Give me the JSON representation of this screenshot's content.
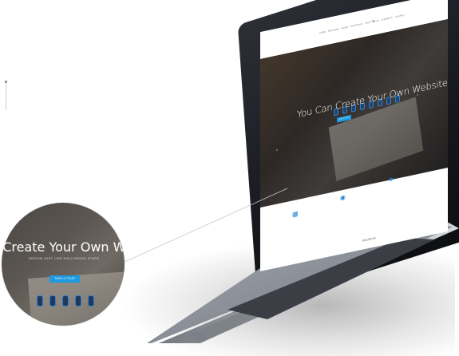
{
  "hero": {
    "title": "You Can Create Your Own Website",
    "cta_label": "TAKE A TOUR"
  },
  "magnifier": {
    "title": "n Create Your Own W",
    "subtitle": "DESIGN JUST LIKE HOLLYWOOD STARS",
    "cta_label": "TAKE A TOUR"
  },
  "device": {
    "brand": "MacBook"
  },
  "nav": {
    "links": [
      "HOME",
      "FEATURES",
      "PAGES",
      "PORTFOLIO",
      "SHOP",
      "BLOG",
      "ELEMENTS",
      "CONTACT"
    ]
  },
  "colors": {
    "accent": "#1e9be0",
    "spiral": "#2f7fd0",
    "laptop_body": "#2c2f36",
    "laptop_base": "#8a8e96"
  },
  "icons": {
    "search": "search-icon",
    "slider_prev": "chevron-left-icon",
    "slider_next": "chevron-right-icon"
  }
}
